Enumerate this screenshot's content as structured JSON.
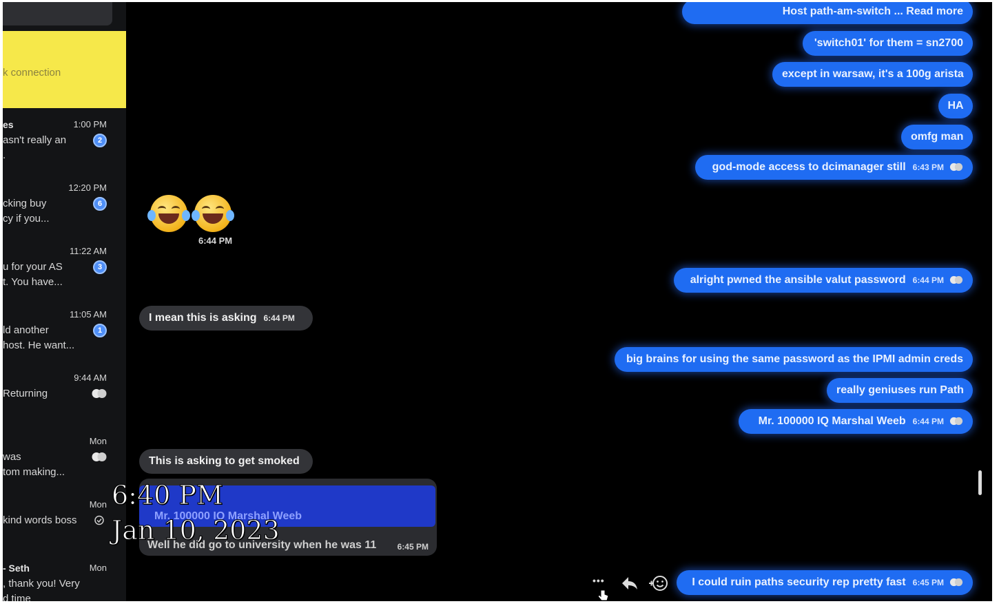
{
  "sidebar": {
    "banner_text": "k connection",
    "conversations": [
      {
        "name": "es",
        "time": "1:00 PM",
        "line1": "asn't really an",
        "line2": ".",
        "badge": "2"
      },
      {
        "name": "",
        "time": "12:20 PM",
        "line1": "cking buy",
        "line2": "cy if you...",
        "badge": "6"
      },
      {
        "name": "",
        "time": "11:22 AM",
        "line1": "u for your AS",
        "line2": "t. You have...",
        "badge": "3"
      },
      {
        "name": "",
        "time": "11:05 AM",
        "line1": "ld another",
        "line2": "host. He want...",
        "badge": "1"
      },
      {
        "name": "",
        "time": "9:44 AM",
        "line1": " Returning",
        "line2": "",
        "badge": ""
      },
      {
        "name": "",
        "time": "Mon",
        "line1": "was",
        "line2": "tom making...",
        "badge": ""
      },
      {
        "name": "",
        "time": "Mon",
        "line1": "kind words boss",
        "line2": "",
        "badge": ""
      },
      {
        "name": "- Seth",
        "time": "Mon",
        "line1": ", thank you! Very",
        "line2": "d time",
        "badge": ""
      }
    ]
  },
  "chat": {
    "outgoing_top": [
      {
        "text": "Host path-am-switch ... Read more",
        "time": ""
      },
      {
        "text": "'switch01' for them = sn2700",
        "time": ""
      },
      {
        "text": "except in warsaw, it's a 100g arista",
        "time": ""
      },
      {
        "text": "HA",
        "time": ""
      },
      {
        "text": "omfg man",
        "time": ""
      },
      {
        "text": "god-mode access to dcimanager still",
        "time": "6:43 PM"
      }
    ],
    "emoji_time": "6:44 PM",
    "incoming_1": {
      "text": "I mean this is asking",
      "time": "6:44 PM"
    },
    "outgoing_mid": {
      "text": "alright pwned the ansible valut password",
      "time": "6:44 PM"
    },
    "outgoing_group": [
      {
        "text": "big brains for using the same password as the IPMI admin creds",
        "time": ""
      },
      {
        "text": "really geniuses run Path",
        "time": ""
      },
      {
        "text": "Mr. 100000 IQ Marshal Weeb",
        "time": "6:44 PM"
      }
    ],
    "incoming_2": {
      "text": "This is asking to get smoked",
      "time": ""
    },
    "reply": {
      "quoted_name": "Mr. 100000 IQ Marshal Weeb",
      "text": "Well he did go to university when he was 11",
      "time": "6:45 PM"
    },
    "outgoing_last": {
      "text": "I could ruin paths security rep pretty fast",
      "time": "6:45 PM"
    }
  },
  "overlay": {
    "time": "6:40 PM",
    "date": "Jan 10, 2023"
  },
  "actions": {
    "more": "•••",
    "reply": "↶",
    "react": "☺"
  },
  "colors": {
    "outgoing_bubble": "#1f6cf2",
    "incoming_bubble": "#333438",
    "banner": "#f6e84a",
    "badge": "#4f8ff7"
  }
}
